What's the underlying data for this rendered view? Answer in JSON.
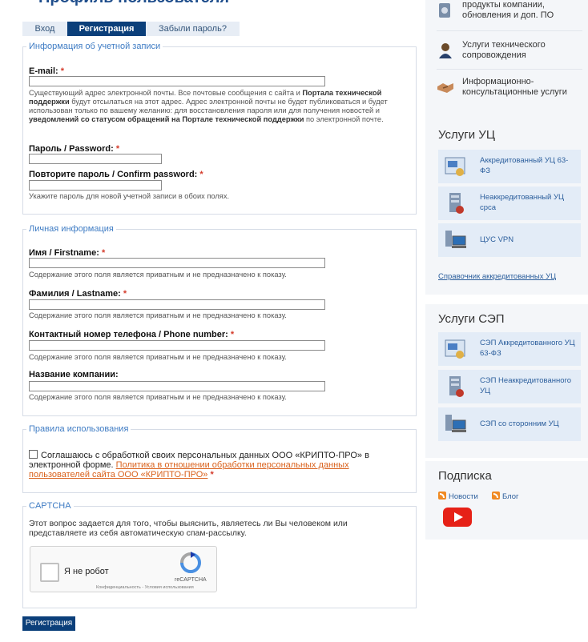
{
  "page_title": "Профиль пользователя",
  "tabs": [
    {
      "label": "Вход"
    },
    {
      "label": "Регистрация"
    },
    {
      "label": "Забыли пароль?"
    }
  ],
  "account": {
    "legend": "Информация об учетной записи",
    "email_label": "E-mail:",
    "email_value": "",
    "email_hint_1": "Существующий адрес электронной почты. Все почтовые сообщения с сайта и ",
    "email_hint_b1": "Портала технической поддержки",
    "email_hint_2": " будут отсылаться на этот адрес. Адрес электронной почты не будет публиковаться и будет использован только по вашему желанию: для восстановления пароля или для получения новостей и ",
    "email_hint_b2": "уведомлений со статусом обращений на Портале технической поддержки",
    "email_hint_3": " по электронной почте.",
    "password_label": "Пароль / Password:",
    "confirm_label": "Повторите пароль / Confirm password:",
    "password_hint": "Укажите пароль для новой учетной записи в обоих полях."
  },
  "personal": {
    "legend": "Личная информация",
    "private_hint": "Содержание этого поля является приватным и не предназначено к показу.",
    "firstname_label": "Имя / Firstname:",
    "lastname_label": "Фамилия / Lastname:",
    "phone_label": "Контактный номер телефона / Phone number:",
    "company_label": "Название компании:"
  },
  "required_mark": "*",
  "rules": {
    "legend": "Правила использования",
    "agree_text": "Соглашаюсь с обработкой своих персональных данных ООО «КРИПТО-ПРО» в электронной форме. ",
    "policy_link": "Политика в отношении обработки персональных данных пользователей сайта ООО «КРИПТО-ПРО»"
  },
  "captcha": {
    "legend": "CAPTCHA",
    "description": "Этот вопрос задается для того, чтобы выяснить, являетесь ли Вы человеком или представляете из себя автоматическую спам-рассылку.",
    "checkbox_label": "Я не робот",
    "brand": "reCAPTCHA",
    "links": "Конфиденциальность - Условия использования"
  },
  "submit_label": "Регистрация",
  "sidebar": {
    "top_items": [
      {
        "label": "продукты компании, обновления и доп. ПО",
        "icon": "disk-icon"
      },
      {
        "label": "Услуги технического сопровождения",
        "icon": "support-person-icon"
      },
      {
        "label": "Информационно-консультационные услуги",
        "icon": "handshake-icon"
      }
    ],
    "uc_heading": "Услуги УЦ",
    "uc_items": [
      {
        "label": "Аккредитованный УЦ 63-ФЗ",
        "icon": "certificate-icon"
      },
      {
        "label": "Неаккредитованный УЦ cpca",
        "icon": "server-icon"
      },
      {
        "label": "ЦУС VPN",
        "icon": "computer-icon"
      }
    ],
    "uc_link": "Справочник аккредитованных УЦ",
    "sep_heading": "Услуги СЭП",
    "sep_items": [
      {
        "label": "СЭП Аккредитованного УЦ 63-ФЗ",
        "icon": "certificate-icon"
      },
      {
        "label": "СЭП Неаккредитованного УЦ",
        "icon": "server-icon"
      },
      {
        "label": "СЭП со сторонним УЦ",
        "icon": "computer-icon"
      }
    ],
    "subscribe_heading": "Подписка",
    "news_label": "Новости",
    "blog_label": "Блог"
  },
  "colors": {
    "primary": "#0b3f7a",
    "link": "#2b5e9c",
    "required": "#d43b2b",
    "policy_link": "#d9611c",
    "youtube": "#e62117"
  }
}
